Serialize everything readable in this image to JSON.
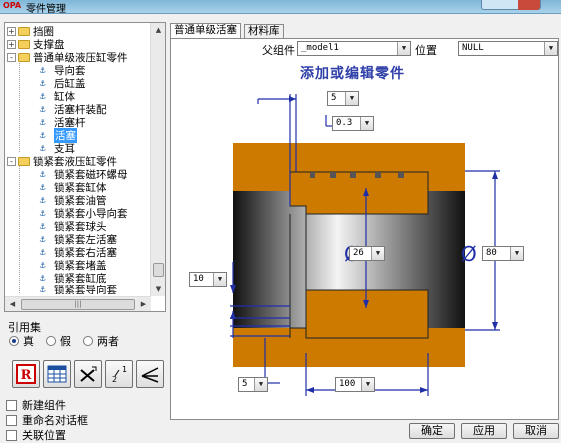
{
  "window": {
    "title": "零件管理",
    "app_icon": "OPA"
  },
  "tree": {
    "rows": [
      {
        "label": "挡圈",
        "level": 0,
        "expander": "+",
        "icon": "folder-icon"
      },
      {
        "label": "支撑盘",
        "level": 0,
        "expander": "+",
        "icon": "folder-icon"
      },
      {
        "label": "普通单级液压缸零件",
        "level": 0,
        "expander": "-",
        "icon": "folder-icon"
      },
      {
        "label": "导向套",
        "level": 1,
        "icon": "part-icon"
      },
      {
        "label": "后缸盖",
        "level": 1,
        "icon": "part-icon"
      },
      {
        "label": "缸体",
        "level": 1,
        "icon": "part-icon"
      },
      {
        "label": "活塞杆装配",
        "level": 1,
        "icon": "part-icon"
      },
      {
        "label": "活塞杆",
        "level": 1,
        "icon": "part-icon"
      },
      {
        "label": "活塞",
        "level": 1,
        "icon": "part-icon",
        "selected": true
      },
      {
        "label": "支耳",
        "level": 1,
        "icon": "part-icon"
      },
      {
        "label": "锁紧套液压缸零件",
        "level": 0,
        "expander": "-",
        "icon": "folder-icon"
      },
      {
        "label": "锁紧套磁环螺母",
        "level": 1,
        "icon": "part-icon"
      },
      {
        "label": "锁紧套缸体",
        "level": 1,
        "icon": "part-icon"
      },
      {
        "label": "锁紧套油管",
        "level": 1,
        "icon": "part-icon"
      },
      {
        "label": "锁紧套小导向套",
        "level": 1,
        "icon": "part-icon"
      },
      {
        "label": "锁紧套球头",
        "level": 1,
        "icon": "part-icon"
      },
      {
        "label": "锁紧套左活塞",
        "level": 1,
        "icon": "part-icon"
      },
      {
        "label": "锁紧套右活塞",
        "level": 1,
        "icon": "part-icon"
      },
      {
        "label": "锁紧套堵盖",
        "level": 1,
        "icon": "part-icon"
      },
      {
        "label": "锁紧套缸底",
        "level": 1,
        "icon": "part-icon"
      },
      {
        "label": "锁紧套导向套",
        "level": 1,
        "icon": "part-icon"
      }
    ]
  },
  "reference_set": {
    "label": "引用集",
    "options": [
      {
        "label": "真",
        "checked": true
      },
      {
        "label": "假",
        "checked": false
      },
      {
        "label": "两者",
        "checked": false
      }
    ]
  },
  "toolbar": {
    "buttons": [
      "report-icon",
      "table-icon",
      "cross-tool-icon",
      "numbering-icon",
      "angle-icon"
    ],
    "report_glyph": "R"
  },
  "checkboxes": [
    {
      "label": "新建组件",
      "checked": false
    },
    {
      "label": "重命名对话框",
      "checked": false
    },
    {
      "label": "关联位置",
      "checked": false
    }
  ],
  "tabs": [
    {
      "label": "普通单级活塞",
      "active": true
    },
    {
      "label": "材料库",
      "active": false
    }
  ],
  "panel": {
    "parent_label": "父组件",
    "parent_value": "_model1",
    "position_label": "位置",
    "position_value": "NULL",
    "heading": "添加或编辑零件"
  },
  "dimensions": {
    "top_width": "5",
    "groove_depth": "0.3",
    "inner_diameter": "26",
    "outer_diameter": "80",
    "left_offset": "10",
    "bottom_left": "5",
    "bottom_length": "100",
    "diameter_symbol": "Ø"
  },
  "buttons": {
    "ok": "确定",
    "apply": "应用",
    "cancel": "取消"
  },
  "colors": {
    "part_fill": "#cc7a00",
    "dim_line": "#1f2fa8",
    "heading": "#2f3fa8",
    "selection": "#3399ff"
  }
}
